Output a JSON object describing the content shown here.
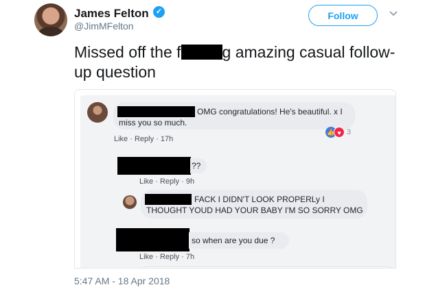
{
  "tweet": {
    "author_name": "James Felton",
    "handle": "@JimMFelton",
    "follow_label": "Follow",
    "text_before": "Missed off the f",
    "text_after": "g amazing casual follow-up question",
    "timestamp": "5:47 AM - 18 Apr 2018",
    "icons": {
      "verified": "verified-badge-icon",
      "more": "chevron-down-icon"
    }
  },
  "embedded_screenshot": {
    "comments": [
      {
        "text": "OMG congratulations! He's beautiful. x I miss you so much.",
        "meta": "Like · Reply · 17h",
        "reaction_count": "3"
      },
      {
        "text": "??",
        "meta": "Like · Reply · 9h"
      },
      {
        "text": "FACK I DIDN'T LOOK PROPERLy I THOUGHT YOUD HAD YOUR BABY I'M SO SORRY OMG"
      },
      {
        "text": "so when are you due ?",
        "meta": "Like · Reply · 7h"
      }
    ]
  },
  "colors": {
    "accent": "#1da1f2",
    "text": "#14171a",
    "muted": "#657786",
    "fb_link": "#385898"
  }
}
